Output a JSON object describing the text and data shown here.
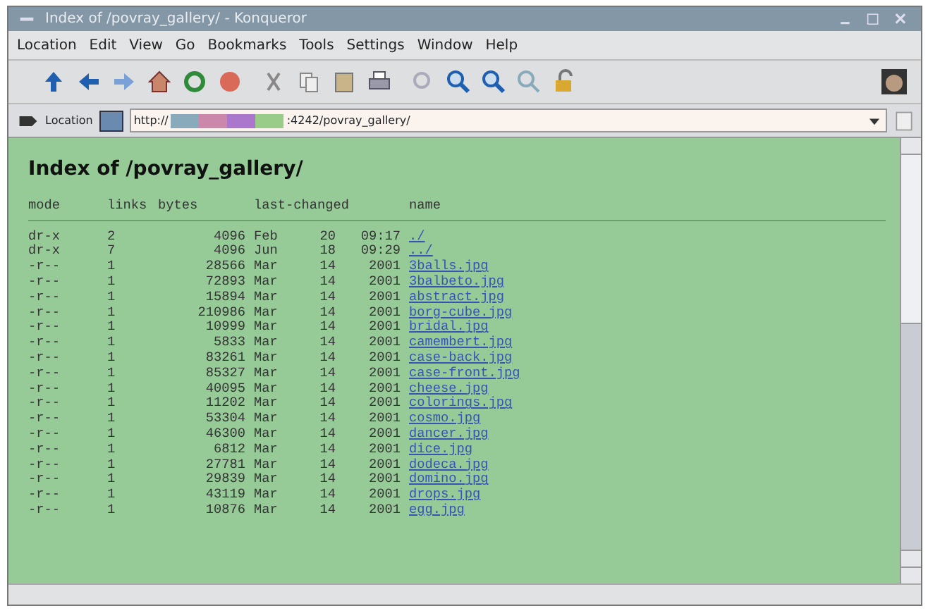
{
  "window": {
    "title": "Index of /povray_gallery/ - Konqueror"
  },
  "menu": [
    "Location",
    "Edit",
    "View",
    "Go",
    "Bookmarks",
    "Tools",
    "Settings",
    "Window",
    "Help"
  ],
  "location_bar": {
    "label": "Location",
    "url_scheme": "http://",
    "url_rest": ":4242/povray_gallery/"
  },
  "page": {
    "heading": "Index of /povray_gallery/",
    "columns": [
      "mode",
      "links",
      "bytes",
      "last-changed",
      "name"
    ],
    "rows": [
      {
        "mode": "dr-x",
        "links": "2",
        "bytes": "4096",
        "month": "Feb",
        "day": "20",
        "time": "09:17",
        "name": "./"
      },
      {
        "mode": "dr-x",
        "links": "7",
        "bytes": "4096",
        "month": "Jun",
        "day": "18",
        "time": "09:29",
        "name": "../"
      },
      {
        "mode": "-r--",
        "links": "1",
        "bytes": "28566",
        "month": "Mar",
        "day": "14",
        "time": "2001",
        "name": "3balls.jpg"
      },
      {
        "mode": "-r--",
        "links": "1",
        "bytes": "72893",
        "month": "Mar",
        "day": "14",
        "time": "2001",
        "name": "3balbeto.jpg"
      },
      {
        "mode": "-r--",
        "links": "1",
        "bytes": "15894",
        "month": "Mar",
        "day": "14",
        "time": "2001",
        "name": "abstract.jpg"
      },
      {
        "mode": "-r--",
        "links": "1",
        "bytes": "210986",
        "month": "Mar",
        "day": "14",
        "time": "2001",
        "name": "borg-cube.jpg"
      },
      {
        "mode": "-r--",
        "links": "1",
        "bytes": "10999",
        "month": "Mar",
        "day": "14",
        "time": "2001",
        "name": "bridal.jpg"
      },
      {
        "mode": "-r--",
        "links": "1",
        "bytes": "5833",
        "month": "Mar",
        "day": "14",
        "time": "2001",
        "name": "camembert.jpg"
      },
      {
        "mode": "-r--",
        "links": "1",
        "bytes": "83261",
        "month": "Mar",
        "day": "14",
        "time": "2001",
        "name": "case-back.jpg"
      },
      {
        "mode": "-r--",
        "links": "1",
        "bytes": "85327",
        "month": "Mar",
        "day": "14",
        "time": "2001",
        "name": "case-front.jpg"
      },
      {
        "mode": "-r--",
        "links": "1",
        "bytes": "40095",
        "month": "Mar",
        "day": "14",
        "time": "2001",
        "name": "cheese.jpg"
      },
      {
        "mode": "-r--",
        "links": "1",
        "bytes": "11202",
        "month": "Mar",
        "day": "14",
        "time": "2001",
        "name": "colorings.jpg"
      },
      {
        "mode": "-r--",
        "links": "1",
        "bytes": "53304",
        "month": "Mar",
        "day": "14",
        "time": "2001",
        "name": "cosmo.jpg"
      },
      {
        "mode": "-r--",
        "links": "1",
        "bytes": "46300",
        "month": "Mar",
        "day": "14",
        "time": "2001",
        "name": "dancer.jpg"
      },
      {
        "mode": "-r--",
        "links": "1",
        "bytes": "6812",
        "month": "Mar",
        "day": "14",
        "time": "2001",
        "name": "dice.jpg"
      },
      {
        "mode": "-r--",
        "links": "1",
        "bytes": "27781",
        "month": "Mar",
        "day": "14",
        "time": "2001",
        "name": "dodeca.jpg"
      },
      {
        "mode": "-r--",
        "links": "1",
        "bytes": "29839",
        "month": "Mar",
        "day": "14",
        "time": "2001",
        "name": "domino.jpg"
      },
      {
        "mode": "-r--",
        "links": "1",
        "bytes": "43119",
        "month": "Mar",
        "day": "14",
        "time": "2001",
        "name": "drops.jpg"
      },
      {
        "mode": "-r--",
        "links": "1",
        "bytes": "10876",
        "month": "Mar",
        "day": "14",
        "time": "2001",
        "name": "egg.jpg"
      }
    ]
  }
}
